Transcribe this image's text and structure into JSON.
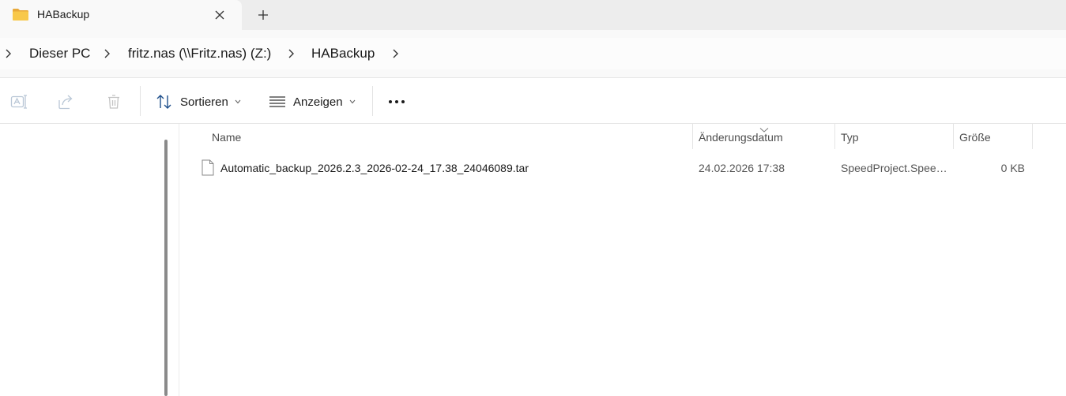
{
  "tab": {
    "title": "HABackup",
    "folder_icon": "folder-icon",
    "close_icon": "close-icon",
    "new_tab_icon": "plus-icon",
    "folder_color": "#f8c84a"
  },
  "breadcrumb": {
    "items": [
      "Dieser PC",
      "fritz.nas (\\\\Fritz.nas) (Z:)",
      "HABackup"
    ]
  },
  "commandbar": {
    "rename_icon": "rename-icon",
    "share_icon": "share-icon",
    "delete_icon": "delete-icon",
    "sort_label": "Sortieren",
    "view_label": "Anzeigen",
    "more_icon": "more-icon"
  },
  "columns": {
    "name": "Name",
    "date": "Änderungsdatum",
    "type": "Typ",
    "size": "Größe"
  },
  "files": [
    {
      "name": "Automatic_backup_2026.2.3_2026-02-24_17.38_24046089.tar",
      "date": "24.02.2026 17:38",
      "type": "SpeedProject.Spee…",
      "size": "0 KB"
    }
  ]
}
